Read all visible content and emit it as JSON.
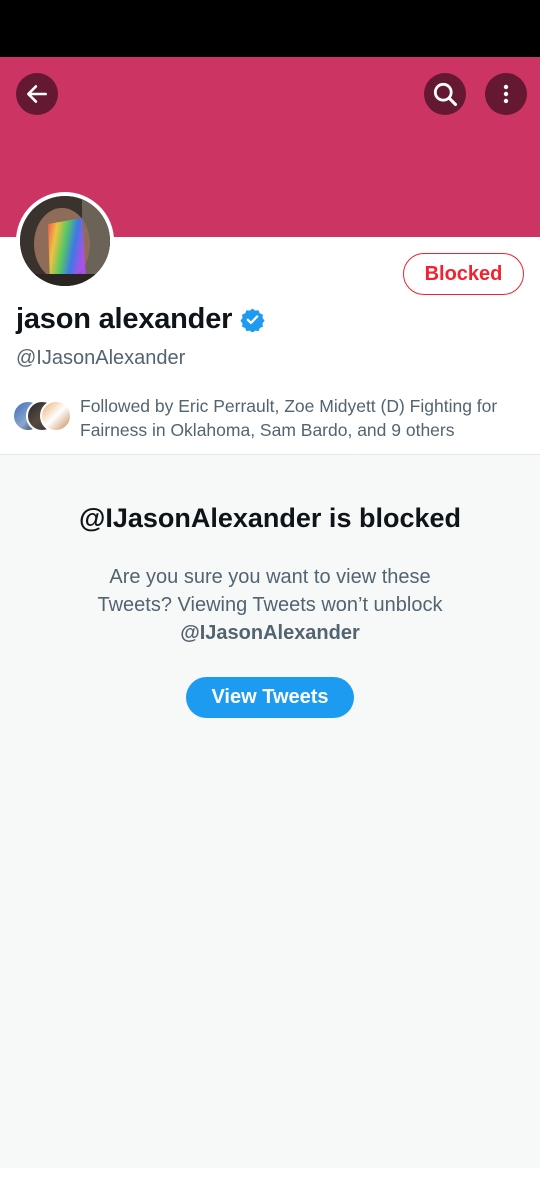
{
  "colors": {
    "banner": "#cc3563",
    "blocked_red": "#f4212e",
    "brand_blue": "#1d9bf0",
    "verified_blue": "#1d9bf0"
  },
  "header": {
    "back_icon": "arrow-left-icon",
    "search_icon": "search-icon",
    "more_icon": "more-vertical-icon"
  },
  "profile": {
    "display_name": "jason alexander",
    "handle": "@IJasonAlexander",
    "verified_icon": "verified-badge-icon",
    "blocked_label": "Blocked",
    "followed_by": "Followed by Eric Perrault, Zoe Midyett (D) Fighting for Fairness in Oklahoma, Sam Bardo, and 9 others"
  },
  "blocked_notice": {
    "title": "@IJasonAlexander is blocked",
    "description": "Are you sure you want to view these Tweets? Viewing Tweets won’t unblock",
    "handle": "@IJasonAlexander",
    "button_label": "View Tweets"
  }
}
